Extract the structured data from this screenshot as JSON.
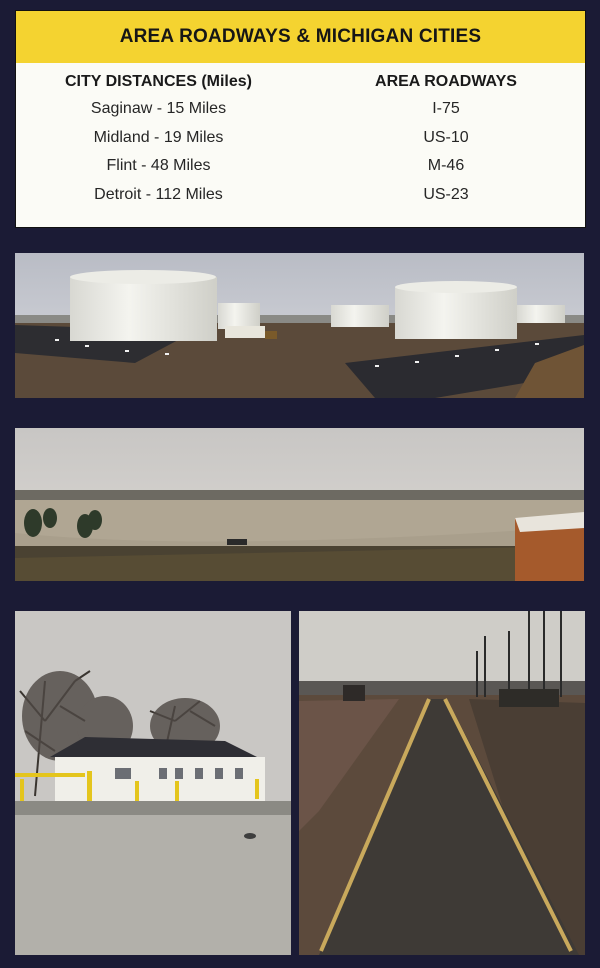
{
  "header": {
    "title": "AREA ROADWAYS & MICHIGAN CITIES"
  },
  "cities": {
    "heading": "CITY DISTANCES (Miles)",
    "items": [
      "Saginaw - 15 Miles",
      "Midland - 19 Miles",
      "Flint - 48 Miles",
      "Detroit - 112 Miles"
    ]
  },
  "roadways": {
    "heading": "AREA ROADWAYS",
    "items": [
      "I-75",
      "US-10",
      "M-46",
      "US-23"
    ]
  },
  "colors": {
    "banner": "#f4d330",
    "background": "#1b1b35",
    "card": "#fbfbf6"
  }
}
